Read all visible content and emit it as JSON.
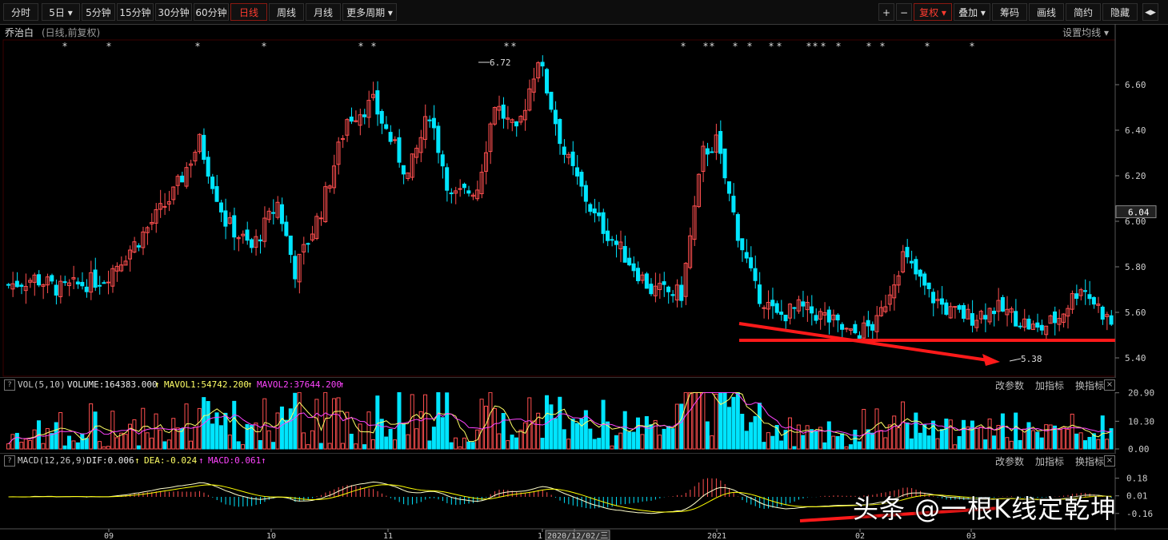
{
  "toolbar": {
    "periods": [
      "分时",
      "5日",
      "5分钟",
      "15分钟",
      "30分钟",
      "60分钟",
      "日线",
      "周线",
      "月线",
      "更多周期"
    ],
    "active_period": "日线",
    "right_buttons": [
      "+",
      "−",
      "复权",
      "叠加",
      "筹码",
      "画线",
      "简约",
      "隐藏"
    ]
  },
  "header": {
    "stock_name": "乔治白",
    "subtitle": "(日线,前复权)",
    "ma_setting": "设置均线"
  },
  "price_axis": {
    "ticks": [
      "6.60",
      "6.40",
      "6.20",
      "6.00",
      "5.80",
      "5.60",
      "5.40"
    ],
    "current": "6.04"
  },
  "annotations": {
    "high": "6.72",
    "low": "5.38"
  },
  "vol_panel": {
    "label": "VOL(5,10)",
    "volume": "VOLUME:164383.000",
    "mavol1": "MAVOL1:54742.200",
    "mavol2": "MAVOL2:37644.200",
    "ticks": [
      "20.90",
      "10.30",
      "0.00"
    ],
    "links": [
      "改参数",
      "加指标",
      "换指标"
    ]
  },
  "macd_panel": {
    "label": "MACD(12,26,9)",
    "dif": "DIF:0.006",
    "dea": "DEA:-0.024",
    "macd": "MACD:0.061",
    "ticks": [
      "0.18",
      "0.01",
      "-0.16"
    ],
    "links": [
      "改参数",
      "加指标",
      "换指标"
    ]
  },
  "date_axis": {
    "labels": [
      "09",
      "10",
      "11",
      "1",
      "2020/12/02/三",
      "2021",
      "02",
      "03"
    ]
  },
  "watermark": "头条 @一根K线定乾坤",
  "colors": {
    "up": "#ff4f4f",
    "down": "#00e5ff",
    "trend": "#ff1a1a",
    "mavol1": "#ffff66",
    "mavol2": "#ff44ff",
    "dif": "#ffffcc",
    "dea": "#ffff00"
  }
}
